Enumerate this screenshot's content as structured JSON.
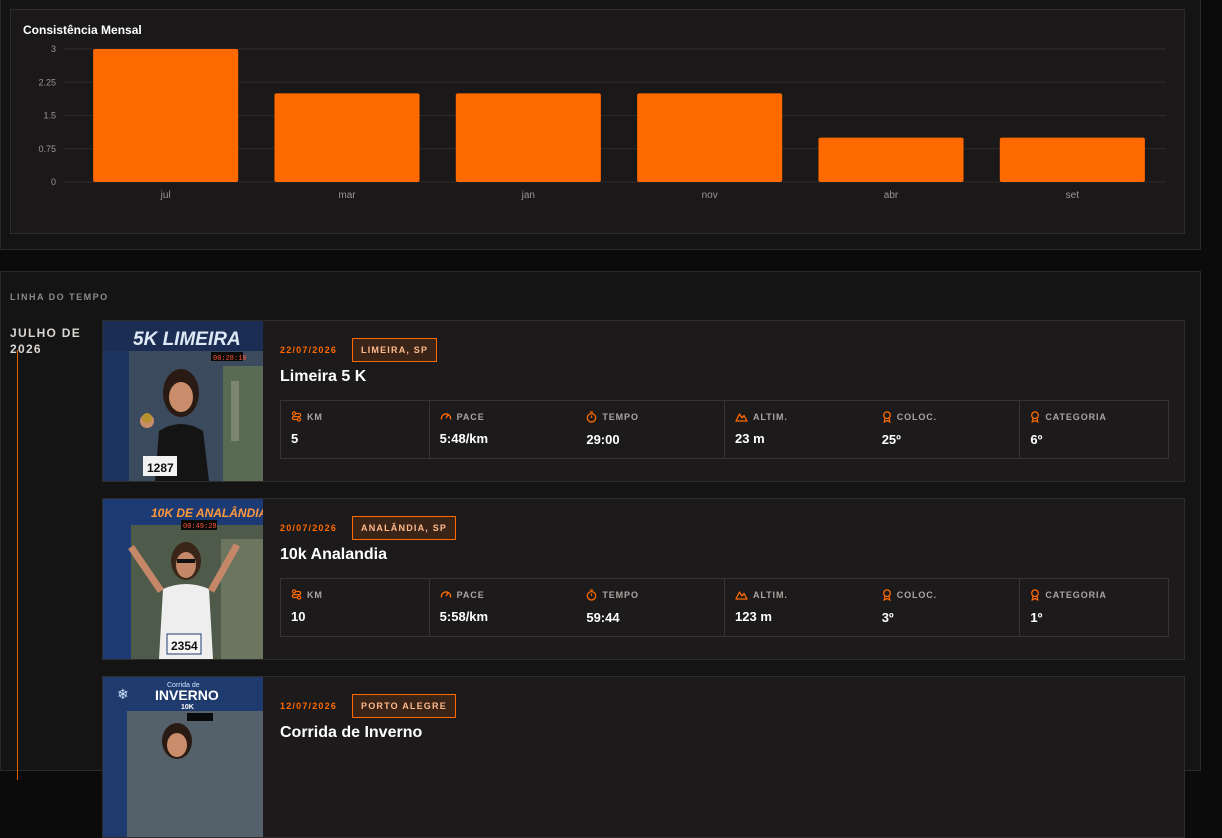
{
  "chart_data": {
    "type": "bar",
    "title": "Consistência Mensal",
    "categories": [
      "jul",
      "mar",
      "jan",
      "nov",
      "abr",
      "set"
    ],
    "values": [
      3,
      2,
      2,
      2,
      1,
      1
    ],
    "yticks": [
      "0",
      "0.75",
      "1.5",
      "2.25",
      "3"
    ],
    "ylim": [
      0,
      3
    ],
    "grid": true,
    "bar_color": "#ff6a00"
  },
  "timeline": {
    "section_label": "LINHA DO TEMPO",
    "month": "JULHO DE 2026",
    "stat_labels": {
      "km": "KM",
      "pace": "PACE",
      "tempo": "TEMPO",
      "altim": "ALTIM.",
      "coloc": "COLOC.",
      "categoria": "CATEGORIA"
    },
    "races": [
      {
        "date": "22/07/2026",
        "place": "LIMEIRA, SP",
        "name": "Limeira 5 K",
        "km": "5",
        "pace": "5:48/km",
        "tempo": "29:00",
        "altim": "23 m",
        "coloc": "25º",
        "categoria": "6º",
        "photo_banner": "5K LIMEIRA",
        "photo_clock": "00:28:10",
        "bib": "1287"
      },
      {
        "date": "20/07/2026",
        "place": "ANALÂNDIA, SP",
        "name": "10k Analandia",
        "km": "10",
        "pace": "5:58/km",
        "tempo": "59:44",
        "altim": "123 m",
        "coloc": "3º",
        "categoria": "1º",
        "photo_banner": "10K DE ANALÂNDIA",
        "photo_clock": "00:49:28",
        "bib": "2354"
      },
      {
        "date": "12/07/2026",
        "place": "PORTO ALEGRE",
        "name": "Corrida de Inverno",
        "photo_banner": "INVERNO",
        "photo_sub": "Corrida de",
        "photo_dist": "10K"
      }
    ]
  },
  "colors": {
    "accent": "#ff6a00",
    "background": "#0c0b0b",
    "card": "#1c1a1a"
  },
  "icons": [
    "route-icon",
    "gauge-icon",
    "stopwatch-icon",
    "mountain-icon",
    "medal-icon",
    "medal-icon"
  ]
}
